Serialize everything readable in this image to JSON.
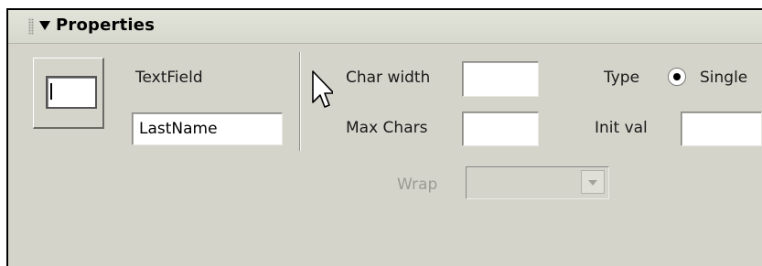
{
  "panel": {
    "title": "Properties"
  },
  "object": {
    "type_label": "TextField",
    "name_value": "LastName"
  },
  "fields": {
    "char_width": {
      "label": "Char width",
      "value": ""
    },
    "max_chars": {
      "label": "Max Chars",
      "value": ""
    },
    "init_val": {
      "label": "Init val",
      "value": ""
    },
    "type": {
      "label": "Type",
      "option_single": "Single",
      "selected": "Single"
    },
    "wrap": {
      "label": "Wrap",
      "value": "",
      "enabled": false
    }
  },
  "icons": {
    "grip": "grip-icon",
    "collapse": "triangle-down-icon",
    "object": "textfield-icon",
    "cursor": "mouse-pointer-icon",
    "dropdown": "chevron-down-icon"
  }
}
